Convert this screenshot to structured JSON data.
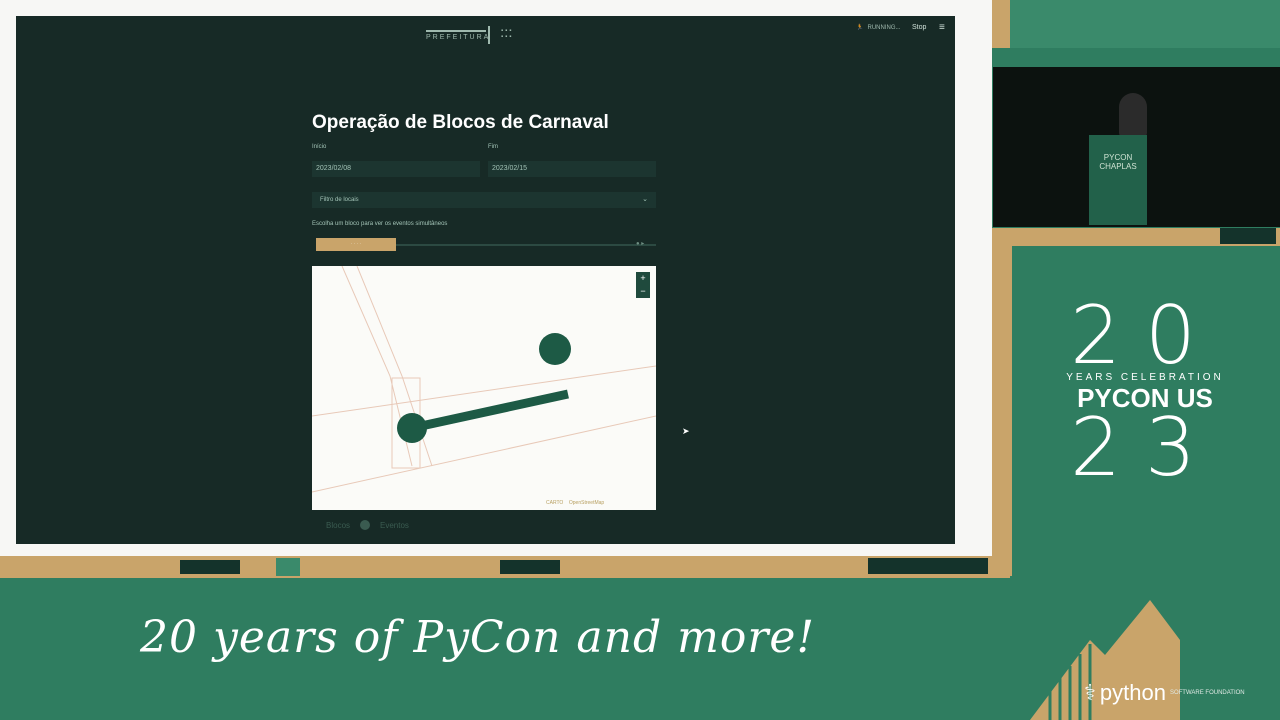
{
  "app": {
    "header_logo_text": "PREFEITURA",
    "status_text": "RUNNING...",
    "stop_label": "Stop",
    "menu_icon": "hamburger-icon"
  },
  "page": {
    "title": "Operação de Blocos de Carnaval",
    "start_label": "Início",
    "start_value": "2023/02/08",
    "end_label": "Fim",
    "end_value": "2023/02/15",
    "locations_placeholder": "Filtro de locais",
    "prompt": "Escolha um bloco para ver os eventos simultâneos"
  },
  "map": {
    "zoom_in": "+",
    "zoom_out": "−",
    "attribution_carto": "CARTO",
    "attribution_osm": "OpenStreetMap"
  },
  "tabs": {
    "left": "Blocos",
    "right": "Eventos"
  },
  "overlay": {
    "video_podium_text": "PYCON CHAPLAS",
    "logo_top": "20",
    "logo_years": "YEARS CELEBRATION",
    "logo_name": "PYCON US",
    "logo_bottom": "23",
    "script_line": "20 years of PyCon and more!",
    "python_wordmark": "python",
    "python_sub": "SOFTWARE FOUNDATION"
  },
  "colors": {
    "screen_bg": "#172a26",
    "accent_tan": "#c9a46a",
    "map_route": "#1d5a45",
    "brand_green": "#2f7d60"
  }
}
